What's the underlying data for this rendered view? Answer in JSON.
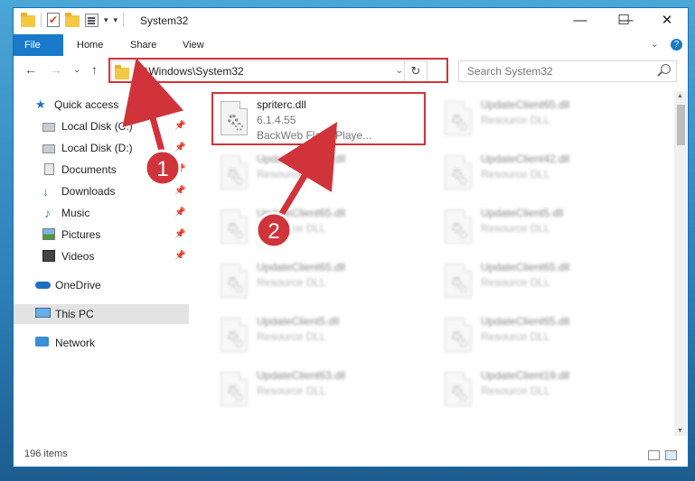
{
  "window": {
    "title": "System32"
  },
  "titlebar": {
    "minimize": "—",
    "maximize": "☐",
    "close": "✕"
  },
  "ribbon": {
    "tabs": [
      "File",
      "Home",
      "Share",
      "View"
    ],
    "expand": "⌄",
    "help": "?"
  },
  "nav": {
    "back": "←",
    "forward": "→",
    "recent": "⌄",
    "up": "↑",
    "address": "C:\\Windows\\System32",
    "address_drop": "⌄",
    "refresh": "↻",
    "search_placeholder": "Search System32"
  },
  "sidebar": {
    "items": [
      {
        "label": "Quick access",
        "icon": "star-icon"
      },
      {
        "label": "Local Disk (C:)",
        "icon": "disk-icon",
        "pinned": true
      },
      {
        "label": "Local Disk (D:)",
        "icon": "disk-icon",
        "pinned": true
      },
      {
        "label": "Documents",
        "icon": "document-icon",
        "pinned": true
      },
      {
        "label": "Downloads",
        "icon": "download-icon",
        "pinned": true
      },
      {
        "label": "Music",
        "icon": "music-icon",
        "pinned": true
      },
      {
        "label": "Pictures",
        "icon": "pictures-icon",
        "pinned": true
      },
      {
        "label": "Videos",
        "icon": "videos-icon",
        "pinned": true
      },
      {
        "label": "OneDrive",
        "icon": "cloud-icon"
      },
      {
        "label": "This PC",
        "icon": "computer-icon",
        "selected": true
      },
      {
        "label": "Network",
        "icon": "network-icon"
      }
    ],
    "pin_glyph": "📌"
  },
  "files": [
    {
      "name": "spriterc.dll",
      "version": "6.1.4.55",
      "description": "BackWeb Flash Playe..."
    },
    {
      "name": "UpdateClient65.dll",
      "description": "Resource DLL"
    },
    {
      "name": "UpdateClient65.dll",
      "description": "Resource DLL"
    },
    {
      "name": "UpdateClient42.dll",
      "description": "Resource DLL"
    },
    {
      "name": "UpdateClient65.dll",
      "description": "Resource DLL"
    },
    {
      "name": "UpdateClient5.dll",
      "description": "Resource DLL"
    },
    {
      "name": "UpdateClient65.dll",
      "description": "Resource DLL"
    },
    {
      "name": "UpdateClient65.dll",
      "description": "Resource DLL"
    },
    {
      "name": "UpdateClient5.dll",
      "description": "Resource DLL"
    },
    {
      "name": "UpdateClient65.dll",
      "description": "Resource DLL"
    },
    {
      "name": "UpdateClient63.dll",
      "description": "Resource DLL"
    },
    {
      "name": "UpdateClient19.dll",
      "description": "Resource DLL"
    }
  ],
  "status": {
    "item_count": "196 items"
  },
  "annotations": {
    "step1": "1",
    "step2": "2",
    "color": "#d0343a"
  },
  "colors": {
    "accent": "#1979ca",
    "highlight": "#d0343a"
  }
}
